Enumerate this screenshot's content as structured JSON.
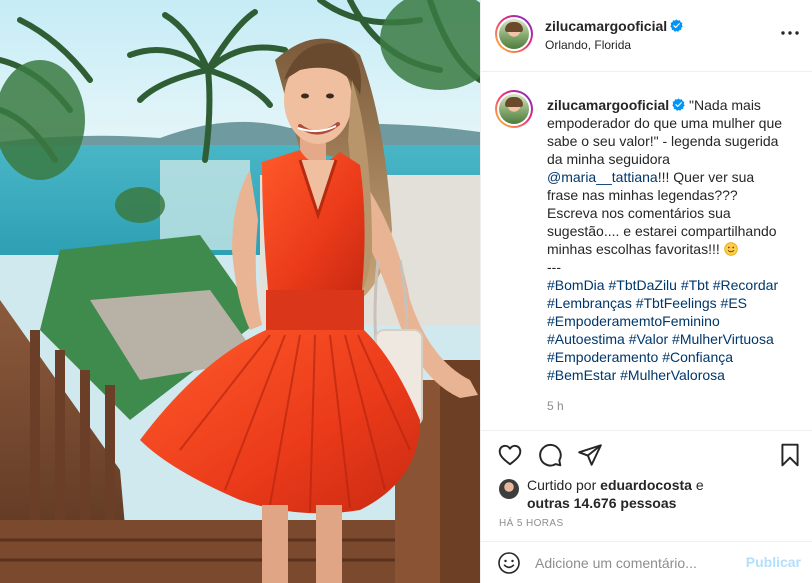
{
  "post": {
    "username": "zilucamargooficial",
    "location": "Orlando, Florida",
    "caption_parts": {
      "quote": "\"Nada mais empoderador do que uma mulher que sabe o seu valor!\" - legenda sugerida da minha seguidora ",
      "mention": "@maria__tattiana",
      "rest": "!!! Quer ver sua frase nas minhas legendas??? Escreva nos comentários sua sugestão.... e estarei compartilhando minhas escolhas favoritas!!!",
      "separator": "---"
    },
    "hashtag_lines": [
      [
        "#BomDia",
        "#TbtDaZilu",
        "#Tbt",
        "#Recordar"
      ],
      [
        "#Lembranças",
        "#TbtFeelings",
        "#ES"
      ],
      [
        "#EmpoderamemtoFeminino"
      ],
      [
        "#Autoestima",
        "#Valor",
        "#MulherVirtuosa"
      ],
      [
        "#Empoderamento",
        "#Confiança"
      ],
      [
        "#BemEstar",
        "#MulherValorosa"
      ]
    ],
    "time_ago": "5 h",
    "likes": {
      "prefix": "Curtido por ",
      "user": "eduardocosta",
      "middle": " e",
      "others": "outras 14.676 pessoas"
    },
    "posted_at": "HÁ 5 HORAS"
  },
  "comment_box": {
    "placeholder": "Adicione um comentário...",
    "publish_label": "Publicar"
  },
  "icons": {
    "verified": "verified-badge-icon",
    "more": "more-options-icon",
    "like": "heart-icon",
    "comment": "comment-bubble-icon",
    "share": "paper-plane-icon",
    "save": "bookmark-icon",
    "emoji": "emoji-smile-icon"
  },
  "colors": {
    "accent_blue": "#0095f6",
    "link_blue": "#00376b",
    "muted": "#8e8e8e",
    "dress_red": "#ee3b1d"
  }
}
